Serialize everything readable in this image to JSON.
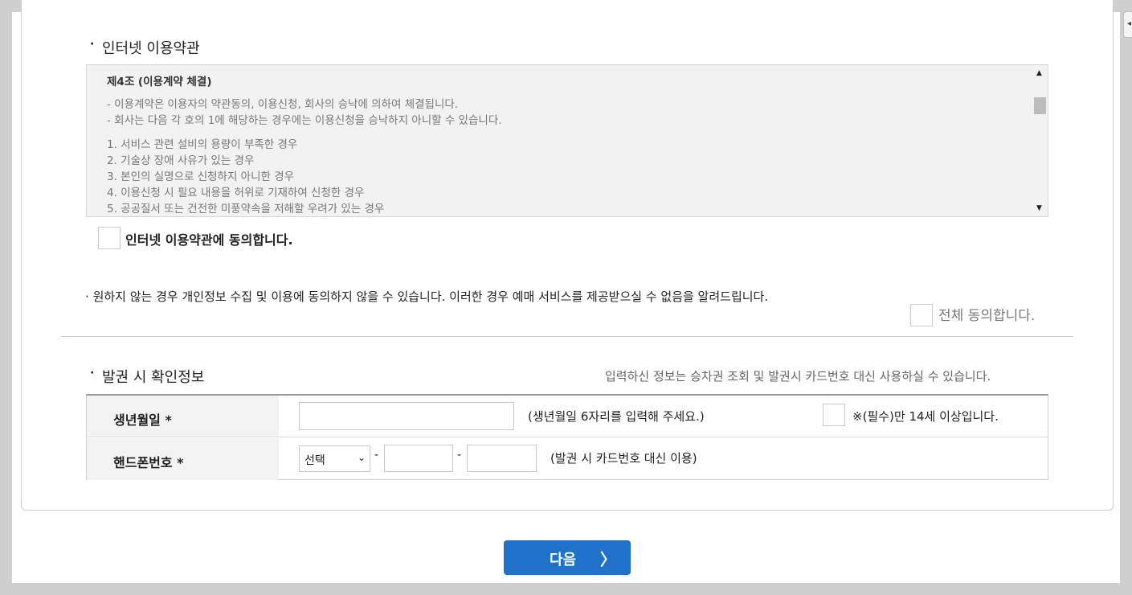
{
  "terms": {
    "section_title": "인터넷 이용약관",
    "article_title": "제4조 (이용계약 체결)",
    "paragraphs": [
      [
        "- 이용계약은 이용자의 약관동의, 이용신청, 회사의 승낙에 의하여 체결됩니다.",
        "- 회사는 다음 각 호의 1에 해당하는 경우에는 이용신청을 승낙하지 아니할 수 있습니다."
      ],
      [
        "1. 서비스 관련 설비의 용량이 부족한 경우",
        "2. 기술상 장애 사유가 있는 경우",
        "3. 본인의 실명으로 신청하지 아니한 경우",
        "4. 이용신청 시 필요 내용을 허위로 기재하여 신청한 경우",
        "5. 공공질서 또는 건전한 미풍약속을 저해할 우려가 있는 경우"
      ]
    ],
    "agree_label": "인터넷 이용약관에 동의합니다."
  },
  "privacy": {
    "notice": "원하지 않는 경우 개인정보 수집 및 이용에 동의하지 않을 수 있습니다. 이러한 경우 예매 서비스를 제공받으실 수 없음을 알려드립니다.",
    "agree_all_label": "전체 동의합니다."
  },
  "issue_info": {
    "section_title": "발권 시 확인정보",
    "note": "입력하신 정보는 승차권 조회 및 발권시 카드번호 대신 사용하실 수 있습니다.",
    "birth": {
      "label": "생년월일 *",
      "value": "",
      "hint": "(생년월일 6자리를 입력해 주세요.)",
      "age_check_label": "※(필수)만 14세 이상입니다."
    },
    "phone": {
      "label": "핸드폰번호 *",
      "select_value": "선택",
      "separator": "-",
      "middle": "",
      "last": "",
      "hint": "(발권 시 카드번호 대신 이용)"
    }
  },
  "footer": {
    "next_label": "다음",
    "next_icon": "chevron-right-icon"
  },
  "colors": {
    "primary": "#1f71c9",
    "terms_bg": "#f2f2f2",
    "header_bg": "#f3f3f3"
  }
}
